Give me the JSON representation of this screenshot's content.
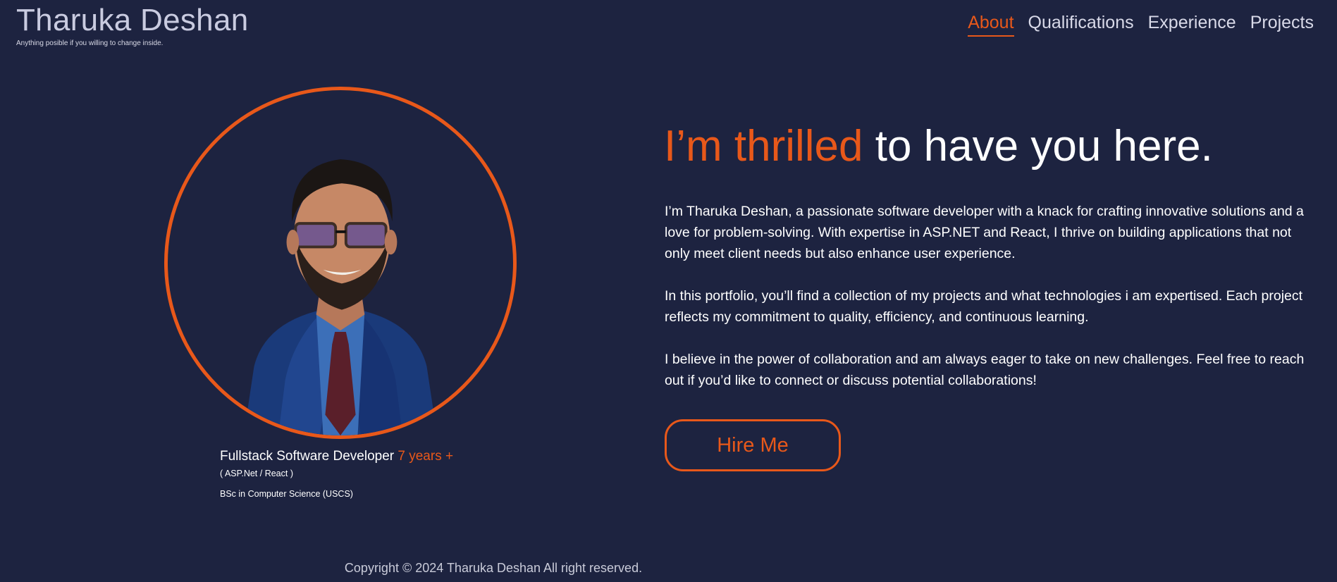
{
  "header": {
    "brand_name": "Tharuka Deshan",
    "tagline": "Anything posible if you willing to change inside.",
    "nav": [
      {
        "label": "About",
        "active": true
      },
      {
        "label": "Qualifications",
        "active": false
      },
      {
        "label": "Experience",
        "active": false
      },
      {
        "label": "Projects",
        "active": false
      }
    ]
  },
  "profile": {
    "role": "Fullstack Software Developer",
    "years": "7 years +",
    "stack": "( ASP.Net / React )",
    "degree": "BSc in Computer Science (USCS)"
  },
  "intro": {
    "headline_accent": "I’m thrilled",
    "headline_rest": " to have you here.",
    "paragraphs": [
      "I’m Tharuka Deshan, a passionate software developer with a knack for crafting innovative solutions and a love for problem-solving. With expertise in ASP.NET and React, I thrive on building applications that not only meet client needs but also enhance user experience.",
      "In this portfolio, you’ll find a collection of my projects and what technologies i am expertised. Each project reflects my commitment to quality, efficiency, and continuous learning.",
      "I believe in the power of collaboration and am always eager to take on new challenges. Feel free to reach out if you’d like to connect or discuss potential collaborations!"
    ],
    "cta_label": "Hire Me"
  },
  "footer": {
    "copyright": "Copyright © 2024 Tharuka Deshan All right reserved."
  },
  "colors": {
    "background": "#1d2340",
    "accent": "#e8581a",
    "text": "#ffffff"
  }
}
